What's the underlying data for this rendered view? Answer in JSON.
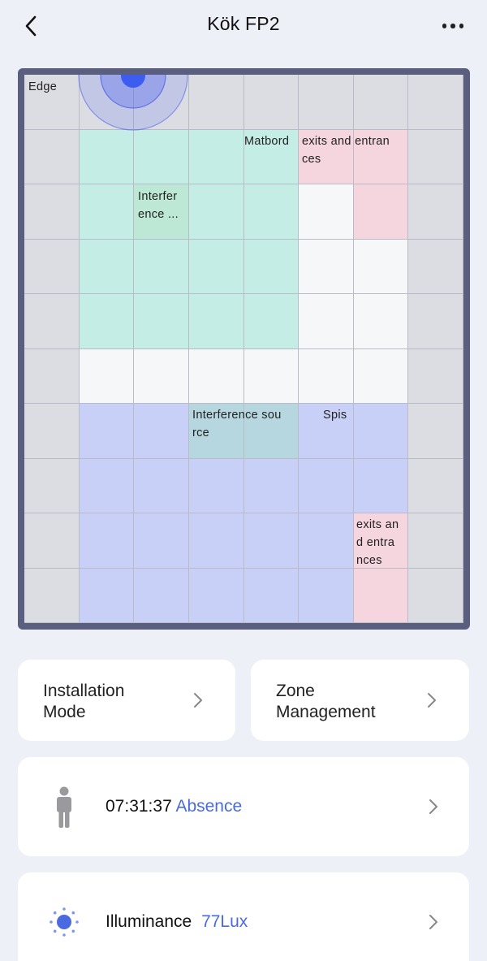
{
  "header": {
    "title": "Kök FP2",
    "back_icon": "chevron-left-icon",
    "more_icon": "more-horizontal-icon"
  },
  "map": {
    "edge_label": "Edge",
    "zones": [
      {
        "name": "matbord",
        "label": "Matbord",
        "color": "#c4ede6"
      },
      {
        "name": "exits-top",
        "label": "exits and entran ces",
        "color": "#f5d5de"
      },
      {
        "name": "interference-1",
        "label": "Interfer ence ...",
        "color": "#bde8d5"
      },
      {
        "name": "spis",
        "label": "Spis",
        "color": "#c8d0f8"
      },
      {
        "name": "interference-2",
        "label": "Interference sou rce",
        "color": "#b7d7e0"
      },
      {
        "name": "exits-bottom",
        "label": "exits an d entra nces",
        "color": "#f5d5de"
      }
    ],
    "colors": {
      "edge": "#dcdde3",
      "empty": "#f6f7f9",
      "frame": "#5a5f80",
      "sensor": "#3d5cf0"
    }
  },
  "buttons": {
    "installation_mode": "Installation Mode",
    "zone_management": "Zone Management"
  },
  "presence": {
    "icon": "person-icon",
    "time": "07:31:37",
    "status": "Absence"
  },
  "illuminance": {
    "icon": "sun-icon",
    "label": "Illuminance",
    "value": "77Lux"
  },
  "colors": {
    "accent": "#4a6ae0",
    "background": "#eef0f8",
    "card": "#ffffff"
  }
}
